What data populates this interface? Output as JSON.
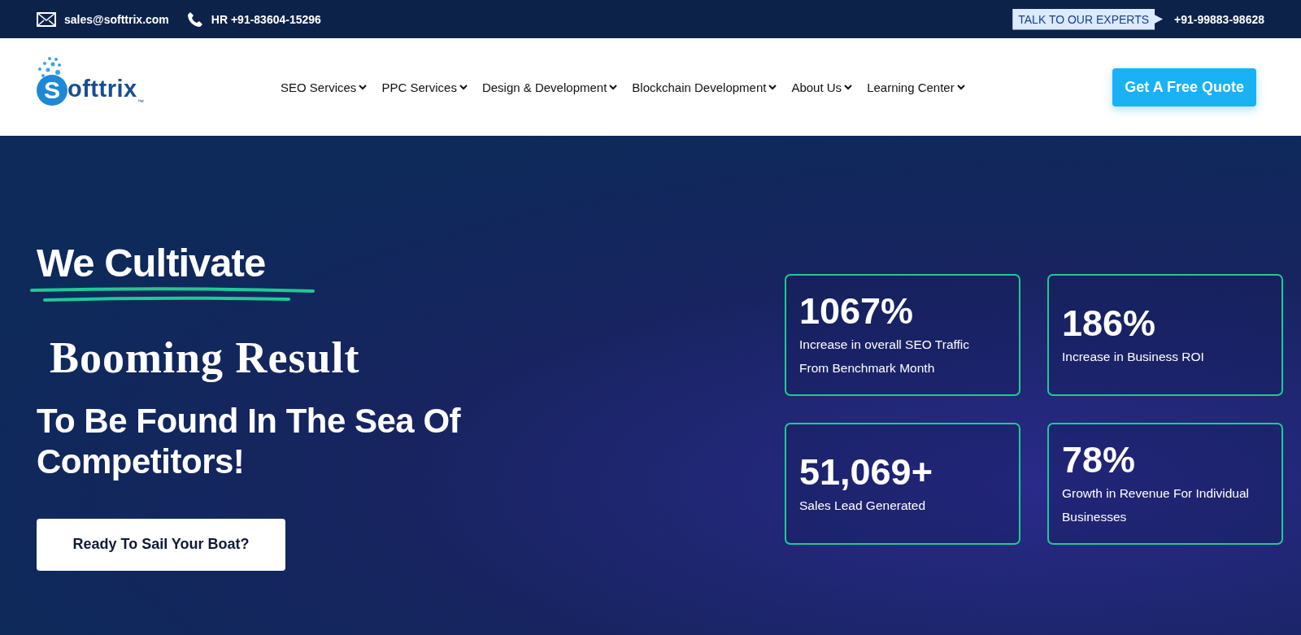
{
  "top_bar": {
    "email": "sales@softtrix.com",
    "phone": "HR +91-83604-15296",
    "cta_label": "TALK TO OUR EXPERTS",
    "cta_phone": "+91-99883-98628"
  },
  "header": {
    "logo_text": "ofttrix",
    "logo_initial": "S",
    "logo_mark": "™",
    "nav": [
      {
        "label": "SEO Services",
        "has_dropdown": true
      },
      {
        "label": "PPC Services",
        "has_dropdown": true
      },
      {
        "label": "Design & Development",
        "has_dropdown": true
      },
      {
        "label": "Blockchain Development",
        "has_dropdown": true
      },
      {
        "label": "About Us",
        "has_dropdown": true
      },
      {
        "label": "Learning Center",
        "has_dropdown": true
      }
    ],
    "quote_button": "Get A Free Quote"
  },
  "hero": {
    "headline": "We Cultivate",
    "rotating_word": "Booming Result",
    "subheadline": "To Be Found In The Sea Of Competitors!",
    "button": "Ready To Sail Your Boat?",
    "stats": [
      {
        "value": "1067%",
        "label": "Increase in overall SEO Traffic From Benchmark Month"
      },
      {
        "value": "186%",
        "label": "Increase in Business ROI"
      },
      {
        "value": "51,069+",
        "label": "Sales Lead Generated"
      },
      {
        "value": "78%",
        "label": "Growth in Revenue For Individual Businesses"
      }
    ]
  }
}
